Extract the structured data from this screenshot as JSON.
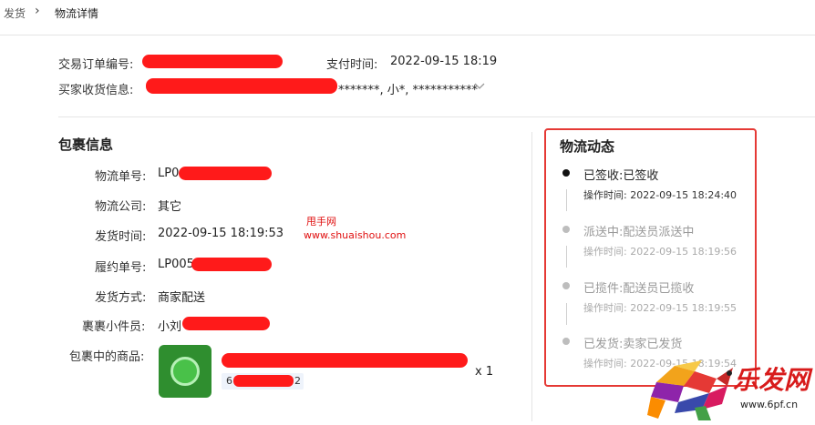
{
  "breadcrumb": {
    "parent": "发货",
    "current": "物流详情"
  },
  "order": {
    "order_no_label": "交易订单编号:",
    "pay_time_label": "支付时间:",
    "pay_time": "2022-09-15 18:19",
    "buyer_label": "买家收货信息:",
    "buyer_tail": "*******, 小*, ***********"
  },
  "package": {
    "title": "包裹信息",
    "tracking_no_label": "物流单号:",
    "tracking_no_prefix": "LP0",
    "carrier_label": "物流公司:",
    "carrier": "其它",
    "ship_time_label": "发货时间:",
    "ship_time": "2022-09-15 18:19:53",
    "fulfil_no_label": "履约单号:",
    "fulfil_no_prefix": "LP005",
    "ship_method_label": "发货方式:",
    "ship_method": "商家配送",
    "courier_label": "裹裹小件员:",
    "courier": "小刘",
    "goods_label": "包裹中的商品:",
    "sku_start": "6",
    "sku_end": "2",
    "qty": "x 1"
  },
  "watermark": {
    "line1": "甩手网",
    "line2": "www.shuaishou.com"
  },
  "tracking": {
    "title": "物流动态",
    "events": [
      {
        "status": "已签收:已签收",
        "time": "操作时间: 2022-09-15 18:24:40"
      },
      {
        "status": "派送中:配送员派送中",
        "time": "操作时间: 2022-09-15 18:19:56"
      },
      {
        "status": "已揽件:配送员已揽收",
        "time": "操作时间: 2022-09-15 18:19:55"
      },
      {
        "status": "已发货:卖家已发货",
        "time": "操作时间: 2022-09-15 18:19:54"
      }
    ]
  },
  "logo": {
    "text": "乐发网",
    "url": "www.6pf.cn"
  },
  "colors": {
    "redaction": "#ff1a1a",
    "panel_border": "#e53935",
    "watermark": "#e01010"
  }
}
